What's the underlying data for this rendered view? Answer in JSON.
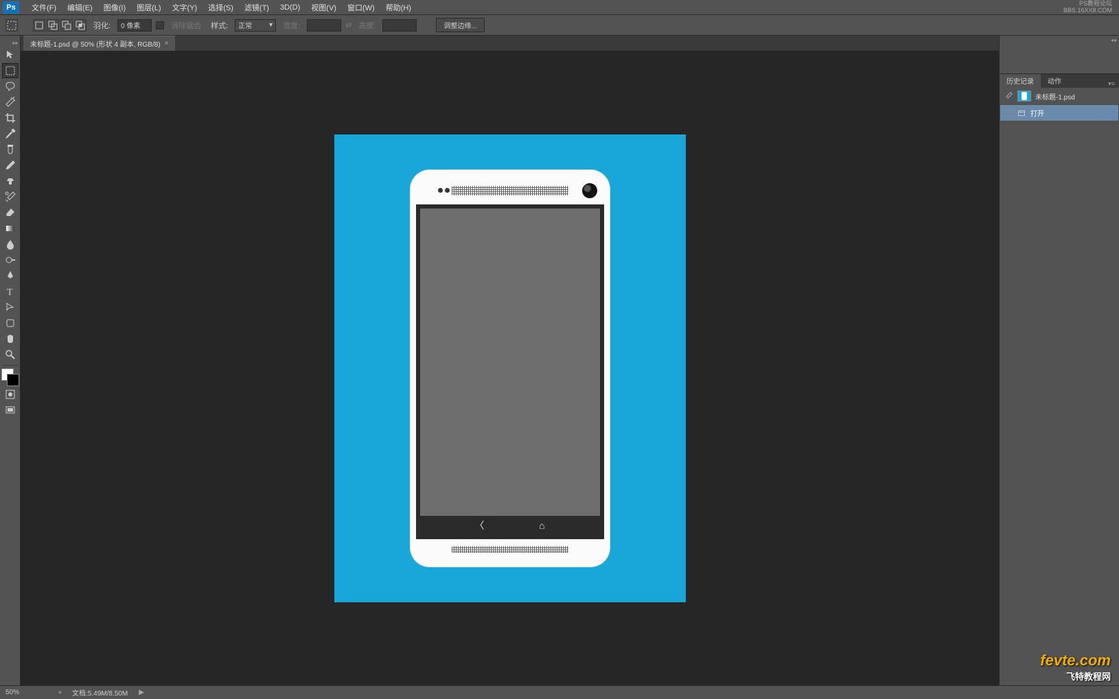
{
  "menubar": {
    "logo": "Ps",
    "items": [
      "文件(F)",
      "编辑(E)",
      "图像(I)",
      "图层(L)",
      "文字(Y)",
      "选择(S)",
      "滤镜(T)",
      "3D(D)",
      "视图(V)",
      "窗口(W)",
      "帮助(H)"
    ],
    "right_line1": "PS教程论坛",
    "right_line2": "BBS.16XX8.COM"
  },
  "optionsbar": {
    "feather_label": "羽化:",
    "feather_value": "0 像素",
    "antialias_label": "消除锯齿",
    "style_label": "样式:",
    "style_value": "正常",
    "width_label": "宽度:",
    "height_label": "高度:",
    "refine_edge": "调整边缘..."
  },
  "tab": {
    "title": "未标题-1.psd @ 50% (形状 4 副本, RGB/8)",
    "close": "×"
  },
  "panels": {
    "history_tab": "历史记录",
    "actions_tab": "动作",
    "doc_name": "未标题-1.psd",
    "open_step": "打开"
  },
  "statusbar": {
    "zoom": "50%",
    "docinfo": "文档:5.49M/8.50M",
    "arrow": "▶"
  },
  "watermark": {
    "brand_prefix": "fe",
    "brand_mid": "v",
    "brand_suffix": "te",
    "brand_tld": ".com",
    "sub": "飞特教程网"
  }
}
